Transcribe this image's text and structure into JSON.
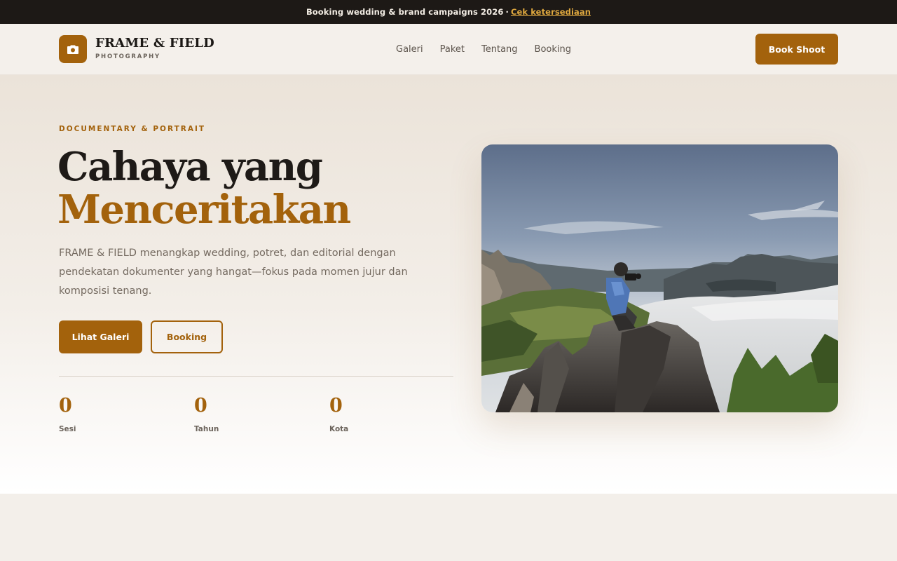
{
  "announcement": {
    "text": "Booking wedding & brand campaigns 2026",
    "separator": "·",
    "link_label": "Cek ketersediaan"
  },
  "header": {
    "brand_name": "FRAME & FIELD",
    "brand_tagline": "PHOTOGRAPHY",
    "logo_icon": "camera-icon",
    "nav": [
      {
        "label": "Galeri"
      },
      {
        "label": "Paket"
      },
      {
        "label": "Tentang"
      },
      {
        "label": "Booking"
      }
    ],
    "cta_label": "Book Shoot"
  },
  "hero": {
    "eyebrow": "DOCUMENTARY & PORTRAIT",
    "title_line1": "Cahaya yang",
    "title_line2": "Menceritakan",
    "description": "FRAME & FIELD menangkap wedding, potret, dan editorial dengan pendekatan dokumenter yang hangat—fokus pada momen jujur dan komposisi tenang.",
    "primary_button": "Lihat Galeri",
    "secondary_button": "Booking",
    "stats": [
      {
        "value": "0",
        "label": "Sesi"
      },
      {
        "value": "0",
        "label": "Tahun"
      },
      {
        "value": "0",
        "label": "Kota"
      }
    ],
    "image_subject": "photographer-on-mountain-peak"
  },
  "colors": {
    "accent": "#a3620c",
    "topbar_bg": "#1d1916",
    "link_highlight": "#e0a93f",
    "text_dark": "#1c1916",
    "text_muted": "#746a60"
  }
}
